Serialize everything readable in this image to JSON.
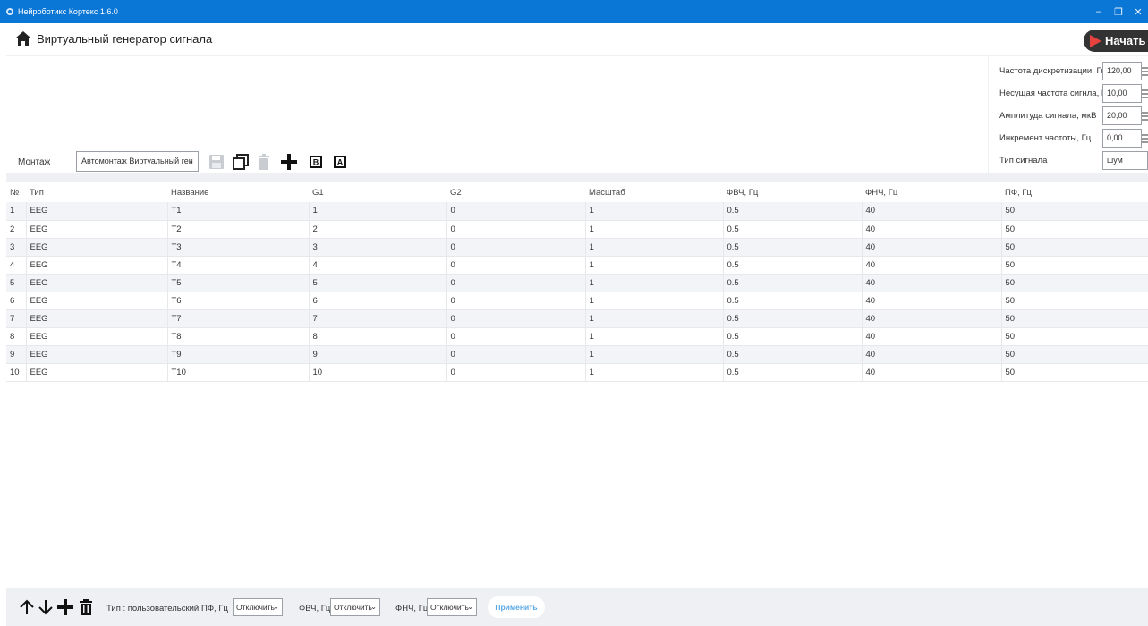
{
  "window": {
    "title": "Нейроботикс Кортекс 1.6.0",
    "controls": {
      "minimize": "–",
      "restore": "❐",
      "close": "✕"
    }
  },
  "header": {
    "title": "Виртуальный генератор сигнала",
    "start_label": "Начать"
  },
  "montage": {
    "label": "Монтаж",
    "selected": "Автомонтаж Виртуальный ген",
    "tools": [
      "save-icon",
      "copy-icon",
      "trash-icon",
      "plus-icon",
      "b-box-icon",
      "a-box-icon"
    ],
    "tool_labels": {
      "b": "B",
      "a": "A"
    }
  },
  "params": [
    {
      "label": "Частота дискретизации, Гц",
      "value": "120,00"
    },
    {
      "label": "Несущая частота сигнла, Гц",
      "value": "10,00"
    },
    {
      "label": "Амплитуда сигнала, мкВ",
      "value": "20,00"
    },
    {
      "label": "Инкремент частоты, Гц",
      "value": "0,00"
    }
  ],
  "signal_type": {
    "label": "Тип сигнала",
    "value": "шум"
  },
  "table": {
    "columns": [
      "№",
      "Тип",
      "Название",
      "G1",
      "G2",
      "Масштаб",
      "ФВЧ, Гц",
      "ФНЧ, Гц",
      "ПФ, Гц"
    ],
    "rows": [
      [
        "1",
        "EEG",
        "T1",
        "1",
        "0",
        "1",
        "0.5",
        "40",
        "50"
      ],
      [
        "2",
        "EEG",
        "T2",
        "2",
        "0",
        "1",
        "0.5",
        "40",
        "50"
      ],
      [
        "3",
        "EEG",
        "T3",
        "3",
        "0",
        "1",
        "0.5",
        "40",
        "50"
      ],
      [
        "4",
        "EEG",
        "T4",
        "4",
        "0",
        "1",
        "0.5",
        "40",
        "50"
      ],
      [
        "5",
        "EEG",
        "T5",
        "5",
        "0",
        "1",
        "0.5",
        "40",
        "50"
      ],
      [
        "6",
        "EEG",
        "T6",
        "6",
        "0",
        "1",
        "0.5",
        "40",
        "50"
      ],
      [
        "7",
        "EEG",
        "T7",
        "7",
        "0",
        "1",
        "0.5",
        "40",
        "50"
      ],
      [
        "8",
        "EEG",
        "T8",
        "8",
        "0",
        "1",
        "0.5",
        "40",
        "50"
      ],
      [
        "9",
        "EEG",
        "T9",
        "9",
        "0",
        "1",
        "0.5",
        "40",
        "50"
      ],
      [
        "10",
        "EEG",
        "T10",
        "10",
        "0",
        "1",
        "0.5",
        "40",
        "50"
      ]
    ]
  },
  "bottom": {
    "type_label": "Тип : пользовательский",
    "pf_label": "ПФ, Гц",
    "pf_value": "Отключить",
    "fvch_label": "ФВЧ, Гц",
    "fvch_value": "Отключить",
    "fnch_label": "ФНЧ, Гц",
    "fnch_value": "Отключить",
    "apply_label": "Применить",
    "icons": [
      "arrow-up-icon",
      "arrow-down-icon",
      "plus-icon",
      "trash-icon"
    ]
  },
  "colors": {
    "titlebar": "#0a76d6",
    "start_button": "#333333",
    "start_accent": "#e8423f",
    "apply_text": "#5aa9e6"
  }
}
